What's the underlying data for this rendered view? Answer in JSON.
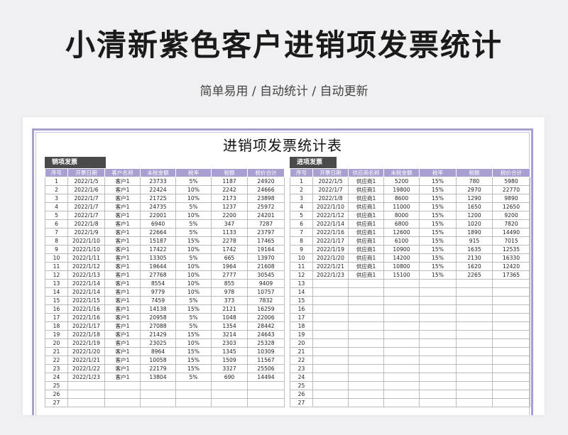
{
  "page": {
    "title": "小清新紫色客户进销项发票统计",
    "subtitle": "简单易用 / 自动统计 / 自动更新"
  },
  "sheet": {
    "title": "进销项发票统计表"
  },
  "sales": {
    "tag": "销项发票",
    "headers": [
      "序号",
      "开票日期",
      "客户名称",
      "未税金额",
      "税率",
      "税额",
      "税价合计"
    ],
    "rows": [
      [
        "1",
        "2022/1/5",
        "客户1",
        "23733",
        "5%",
        "1187",
        "24920"
      ],
      [
        "2",
        "2022/1/6",
        "客户1",
        "22424",
        "10%",
        "2242",
        "24666"
      ],
      [
        "3",
        "2022/1/7",
        "客户1",
        "21725",
        "10%",
        "2173",
        "23898"
      ],
      [
        "4",
        "2022/1/7",
        "客户1",
        "24735",
        "5%",
        "1237",
        "25972"
      ],
      [
        "5",
        "2022/1/7",
        "客户1",
        "22001",
        "10%",
        "2200",
        "24201"
      ],
      [
        "6",
        "2022/1/8",
        "客户1",
        "6940",
        "5%",
        "347",
        "7287"
      ],
      [
        "7",
        "2022/1/9",
        "客户1",
        "22664",
        "5%",
        "1133",
        "23797"
      ],
      [
        "8",
        "2022/1/10",
        "客户1",
        "15187",
        "15%",
        "2278",
        "17465"
      ],
      [
        "9",
        "2022/1/10",
        "客户1",
        "17422",
        "10%",
        "1742",
        "19164"
      ],
      [
        "10",
        "2022/1/11",
        "客户1",
        "13305",
        "5%",
        "665",
        "13970"
      ],
      [
        "11",
        "2022/1/12",
        "客户1",
        "19644",
        "10%",
        "1964",
        "21608"
      ],
      [
        "12",
        "2022/1/13",
        "客户1",
        "27768",
        "10%",
        "2777",
        "30545"
      ],
      [
        "13",
        "2022/1/14",
        "客户1",
        "8554",
        "10%",
        "855",
        "9409"
      ],
      [
        "14",
        "2022/1/14",
        "客户1",
        "9779",
        "10%",
        "978",
        "10757"
      ],
      [
        "15",
        "2022/1/15",
        "客户1",
        "7459",
        "5%",
        "373",
        "7832"
      ],
      [
        "16",
        "2022/1/16",
        "客户1",
        "14138",
        "15%",
        "2121",
        "16259"
      ],
      [
        "17",
        "2022/1/16",
        "客户1",
        "20958",
        "5%",
        "1048",
        "22006"
      ],
      [
        "18",
        "2022/1/17",
        "客户1",
        "27088",
        "5%",
        "1354",
        "28442"
      ],
      [
        "19",
        "2022/1/18",
        "客户1",
        "21429",
        "15%",
        "3214",
        "24643"
      ],
      [
        "20",
        "2022/1/19",
        "客户1",
        "23025",
        "10%",
        "2303",
        "25328"
      ],
      [
        "21",
        "2022/1/20",
        "客户1",
        "8964",
        "15%",
        "1345",
        "10309"
      ],
      [
        "22",
        "2022/1/21",
        "客户1",
        "10058",
        "15%",
        "1509",
        "11567"
      ],
      [
        "23",
        "2022/1/22",
        "客户1",
        "22179",
        "15%",
        "3327",
        "25506"
      ],
      [
        "24",
        "2022/1/23",
        "客户1",
        "13804",
        "5%",
        "690",
        "14494"
      ],
      [
        "25",
        "",
        "",
        "",
        "",
        "",
        ""
      ],
      [
        "26",
        "",
        "",
        "",
        "",
        "",
        ""
      ],
      [
        "27",
        "",
        "",
        "",
        "",
        "",
        ""
      ]
    ]
  },
  "purchase": {
    "tag": "进项发票",
    "headers": [
      "序号",
      "开票日期",
      "供应商名称",
      "未税金额",
      "税率",
      "税额",
      "税价合计"
    ],
    "rows": [
      [
        "1",
        "2022/1/5",
        "供应商1",
        "5200",
        "15%",
        "780",
        "5980"
      ],
      [
        "2",
        "2022/1/7",
        "供应商1",
        "19800",
        "15%",
        "2970",
        "22770"
      ],
      [
        "3",
        "2022/1/8",
        "供应商1",
        "8600",
        "15%",
        "1290",
        "9890"
      ],
      [
        "4",
        "2022/1/10",
        "供应商1",
        "11000",
        "15%",
        "1650",
        "12650"
      ],
      [
        "5",
        "2022/1/12",
        "供应商1",
        "8000",
        "15%",
        "1200",
        "9200"
      ],
      [
        "6",
        "2022/1/14",
        "供应商1",
        "6800",
        "15%",
        "1020",
        "7820"
      ],
      [
        "7",
        "2022/1/16",
        "供应商1",
        "12600",
        "15%",
        "1890",
        "14490"
      ],
      [
        "8",
        "2022/1/17",
        "供应商1",
        "6100",
        "15%",
        "915",
        "7015"
      ],
      [
        "9",
        "2022/1/19",
        "供应商1",
        "10900",
        "15%",
        "1635",
        "12535"
      ],
      [
        "10",
        "2022/1/20",
        "供应商1",
        "14200",
        "15%",
        "2130",
        "16330"
      ],
      [
        "11",
        "2022/1/21",
        "供应商1",
        "10800",
        "15%",
        "1620",
        "12420"
      ],
      [
        "12",
        "2022/1/23",
        "供应商1",
        "15100",
        "15%",
        "2265",
        "17365"
      ],
      [
        "13",
        "",
        "",
        "",
        "",
        "",
        ""
      ],
      [
        "14",
        "",
        "",
        "",
        "",
        "",
        ""
      ],
      [
        "15",
        "",
        "",
        "",
        "",
        "",
        ""
      ],
      [
        "16",
        "",
        "",
        "",
        "",
        "",
        ""
      ],
      [
        "17",
        "",
        "",
        "",
        "",
        "",
        ""
      ],
      [
        "18",
        "",
        "",
        "",
        "",
        "",
        ""
      ],
      [
        "19",
        "",
        "",
        "",
        "",
        "",
        ""
      ],
      [
        "20",
        "",
        "",
        "",
        "",
        "",
        ""
      ],
      [
        "21",
        "",
        "",
        "",
        "",
        "",
        ""
      ],
      [
        "22",
        "",
        "",
        "",
        "",
        "",
        ""
      ],
      [
        "23",
        "",
        "",
        "",
        "",
        "",
        ""
      ],
      [
        "24",
        "",
        "",
        "",
        "",
        "",
        ""
      ],
      [
        "25",
        "",
        "",
        "",
        "",
        "",
        ""
      ],
      [
        "26",
        "",
        "",
        "",
        "",
        "",
        ""
      ],
      [
        "27",
        "",
        "",
        "",
        "",
        "",
        ""
      ]
    ]
  },
  "colors": {
    "accent": "#a99fd0",
    "tag_bg": "#4a4a4a",
    "background": "#f0eff1"
  }
}
